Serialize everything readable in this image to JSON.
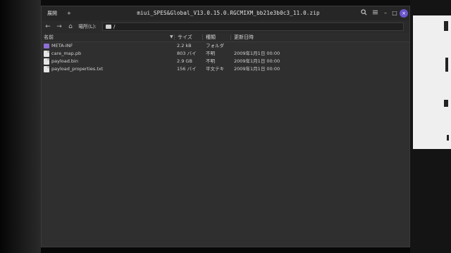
{
  "window": {
    "title": "miui_SPES&Global_V13.0.15.0.RGCMIXM_bb21e3b0c3_11.0.zip",
    "open_label": "展開",
    "add_label": "+",
    "search_icon": "search-icon",
    "menu_icon": "menu-icon",
    "minimize_label": "–",
    "maximize_label": "□",
    "close_label": "×"
  },
  "pathbar": {
    "back": "←",
    "forward": "→",
    "home": "⌂",
    "location_label": "場所(L):",
    "path": "/"
  },
  "columns": {
    "name": "名前",
    "size": "サイズ",
    "type": "種類",
    "modified": "更新日時"
  },
  "files": [
    {
      "name": "META-INF",
      "size": "2.2 kB",
      "type": "フォルダ",
      "modified": "",
      "kind": "folder"
    },
    {
      "name": "care_map.pb",
      "size": "803 バイ",
      "type": "不明",
      "modified": "2009年1月1日 00:00",
      "kind": "file"
    },
    {
      "name": "payload.bin",
      "size": "2.9 GB",
      "type": "不明",
      "modified": "2009年1月1日 00:00",
      "kind": "file"
    },
    {
      "name": "payload_properties.txt",
      "size": "156 バイ",
      "type": "平文テキ",
      "modified": "2009年1月1日 00:00",
      "kind": "file"
    }
  ],
  "colors": {
    "window_bg": "#2f2f2f",
    "titlebar_bg": "#262626",
    "folder_icon": "#8f6fd6",
    "close_button": "#6b55c9"
  }
}
